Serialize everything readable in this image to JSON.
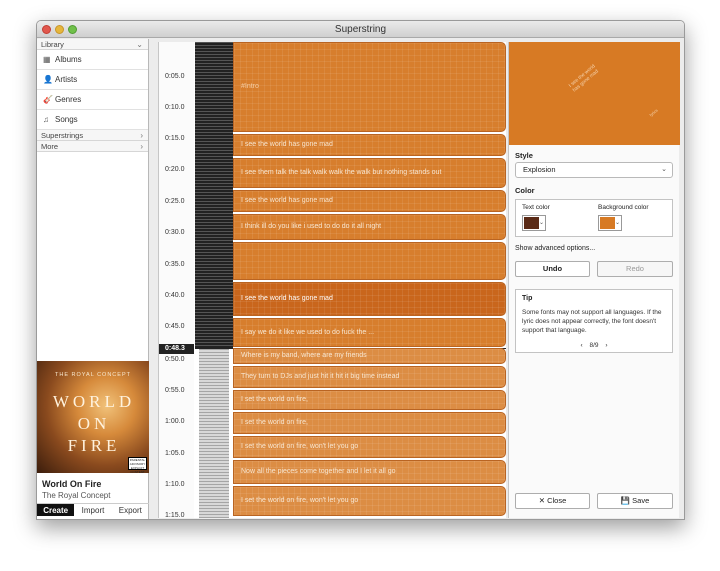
{
  "window": {
    "title": "Superstring"
  },
  "sidebar": {
    "library_label": "Library",
    "items": [
      {
        "label": "Albums",
        "icon": "albums-icon"
      },
      {
        "label": "Artists",
        "icon": "person-icon"
      },
      {
        "label": "Genres",
        "icon": "guitar-icon"
      },
      {
        "label": "Songs",
        "icon": "music-note-icon"
      }
    ],
    "superstrings_label": "Superstrings",
    "more_label": "More"
  },
  "now_playing": {
    "art_top": "THE ROYAL CONCEPT",
    "art_line1": "WORLD",
    "art_line2": "ON",
    "art_line3": "FIRE",
    "advisory": "PARENTAL ADVISORY EXPLICIT CONTENT",
    "title": "World On Fire",
    "artist": "The Royal Concept"
  },
  "tabs": {
    "create": "Create",
    "import": "Import",
    "export": "Export"
  },
  "player": {
    "volume": "🔈",
    "repeat": "↻",
    "rewind": "◀◀",
    "pause": "❚❚",
    "forward": "▶▶",
    "shuffle": "✛",
    "pin": "✎"
  },
  "timeline": {
    "cursor_time": "0:48.3",
    "time_labels": [
      "0:05.0",
      "0:10.0",
      "0:15.0",
      "0:20.0",
      "0:25.0",
      "0:30.0",
      "0:35.0",
      "0:40.0",
      "0:45.0",
      "0:50.0",
      "0:55.0",
      "1:00.0",
      "1:05.0",
      "1:10.0",
      "1:15.0"
    ],
    "lyrics": [
      "#Intro",
      "I see the world has gone mad",
      "I see them talk the talk walk walk the walk but nothing stands out",
      "I see the world has gone mad",
      "I think ill do you like i used to do do it all night",
      "",
      "I see the world has gone mad",
      "I say we do it like we used to do fuck the ...",
      "Where is my band, where are my friends",
      "They turn to DJs and just hit it hit it big time instead",
      "I set the world on fire,",
      "I set the world on fire,",
      "I set the world on fire, won't let you go",
      "Now all the pieces come together and I let it all go",
      "I set the world on fire, won't let you go"
    ]
  },
  "panel": {
    "preview_text": "I see the world has gone mad",
    "preview_small": "lyrics",
    "style_label": "Style",
    "style_value": "Explosion",
    "color_label": "Color",
    "text_color_label": "Text color",
    "text_color": "#5a2a16",
    "bg_color_label": "Background color",
    "bg_color": "#d77a24",
    "advanced_label": "Show advanced options...",
    "undo_label": "Undo",
    "redo_label": "Redo",
    "tip_title": "Tip",
    "tip_text": "Some fonts may not support all languages. If the lyric does not appear correctly, the font doesn't support that language.",
    "tip_page": "8/9",
    "tip_prev": "‹",
    "tip_next": "›",
    "close_label": "Close",
    "close_icon": "✕",
    "save_label": "Save",
    "save_icon": "💾"
  }
}
